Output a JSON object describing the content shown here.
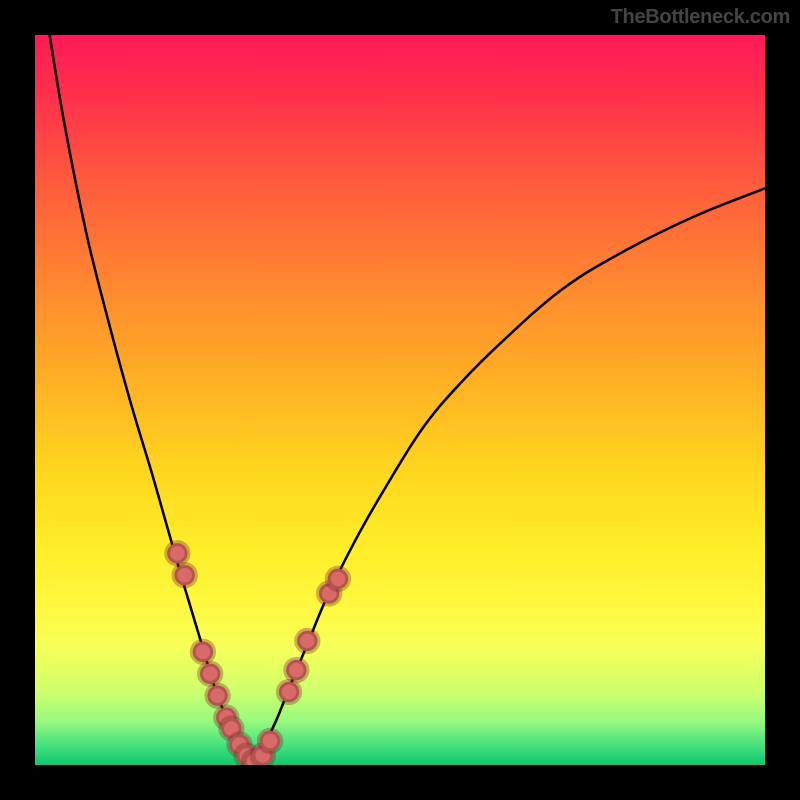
{
  "watermark": "TheBottleneck.com",
  "colors": {
    "frame": "#000000",
    "dot": "#d86a68",
    "curve": "#000000",
    "gradient_top": "#ff1a56",
    "gradient_bottom": "#0fc86e"
  },
  "chart_data": {
    "type": "line",
    "title": "",
    "xlabel": "",
    "ylabel": "",
    "xlim": [
      0,
      100
    ],
    "ylim": [
      0,
      100
    ],
    "grid": false,
    "legend": false,
    "series": [
      {
        "name": "left-branch",
        "x": [
          2,
          4,
          7,
          10,
          13,
          16,
          18,
          20,
          21.5,
          23,
          24.5,
          26,
          27.5,
          29,
          30
        ],
        "y": [
          100,
          88,
          73,
          61,
          50,
          40,
          33,
          26,
          21,
          16,
          11,
          7,
          4,
          1.5,
          0
        ]
      },
      {
        "name": "right-branch",
        "x": [
          30,
          31,
          33,
          35,
          37.5,
          40,
          44,
          48,
          53,
          58,
          64,
          72,
          80,
          90,
          100
        ],
        "y": [
          0,
          2,
          6,
          11,
          17,
          23,
          31,
          38,
          46,
          52,
          58,
          65,
          70,
          75,
          79
        ]
      }
    ],
    "markers": {
      "name": "highlight-dots",
      "points": [
        {
          "x": 19.5,
          "y": 29
        },
        {
          "x": 20.5,
          "y": 26
        },
        {
          "x": 23.0,
          "y": 15.5
        },
        {
          "x": 24.0,
          "y": 12.5
        },
        {
          "x": 25.0,
          "y": 9.5
        },
        {
          "x": 26.2,
          "y": 6.5
        },
        {
          "x": 26.9,
          "y": 5.0
        },
        {
          "x": 28.0,
          "y": 2.8
        },
        {
          "x": 29.0,
          "y": 1.3
        },
        {
          "x": 30.0,
          "y": 0.5
        },
        {
          "x": 31.2,
          "y": 1.3
        },
        {
          "x": 32.2,
          "y": 3.3
        },
        {
          "x": 34.8,
          "y": 10.0
        },
        {
          "x": 35.8,
          "y": 13.0
        },
        {
          "x": 37.3,
          "y": 17.0
        },
        {
          "x": 40.3,
          "y": 23.5
        },
        {
          "x": 41.5,
          "y": 25.5
        }
      ],
      "radius": 1.4
    }
  }
}
